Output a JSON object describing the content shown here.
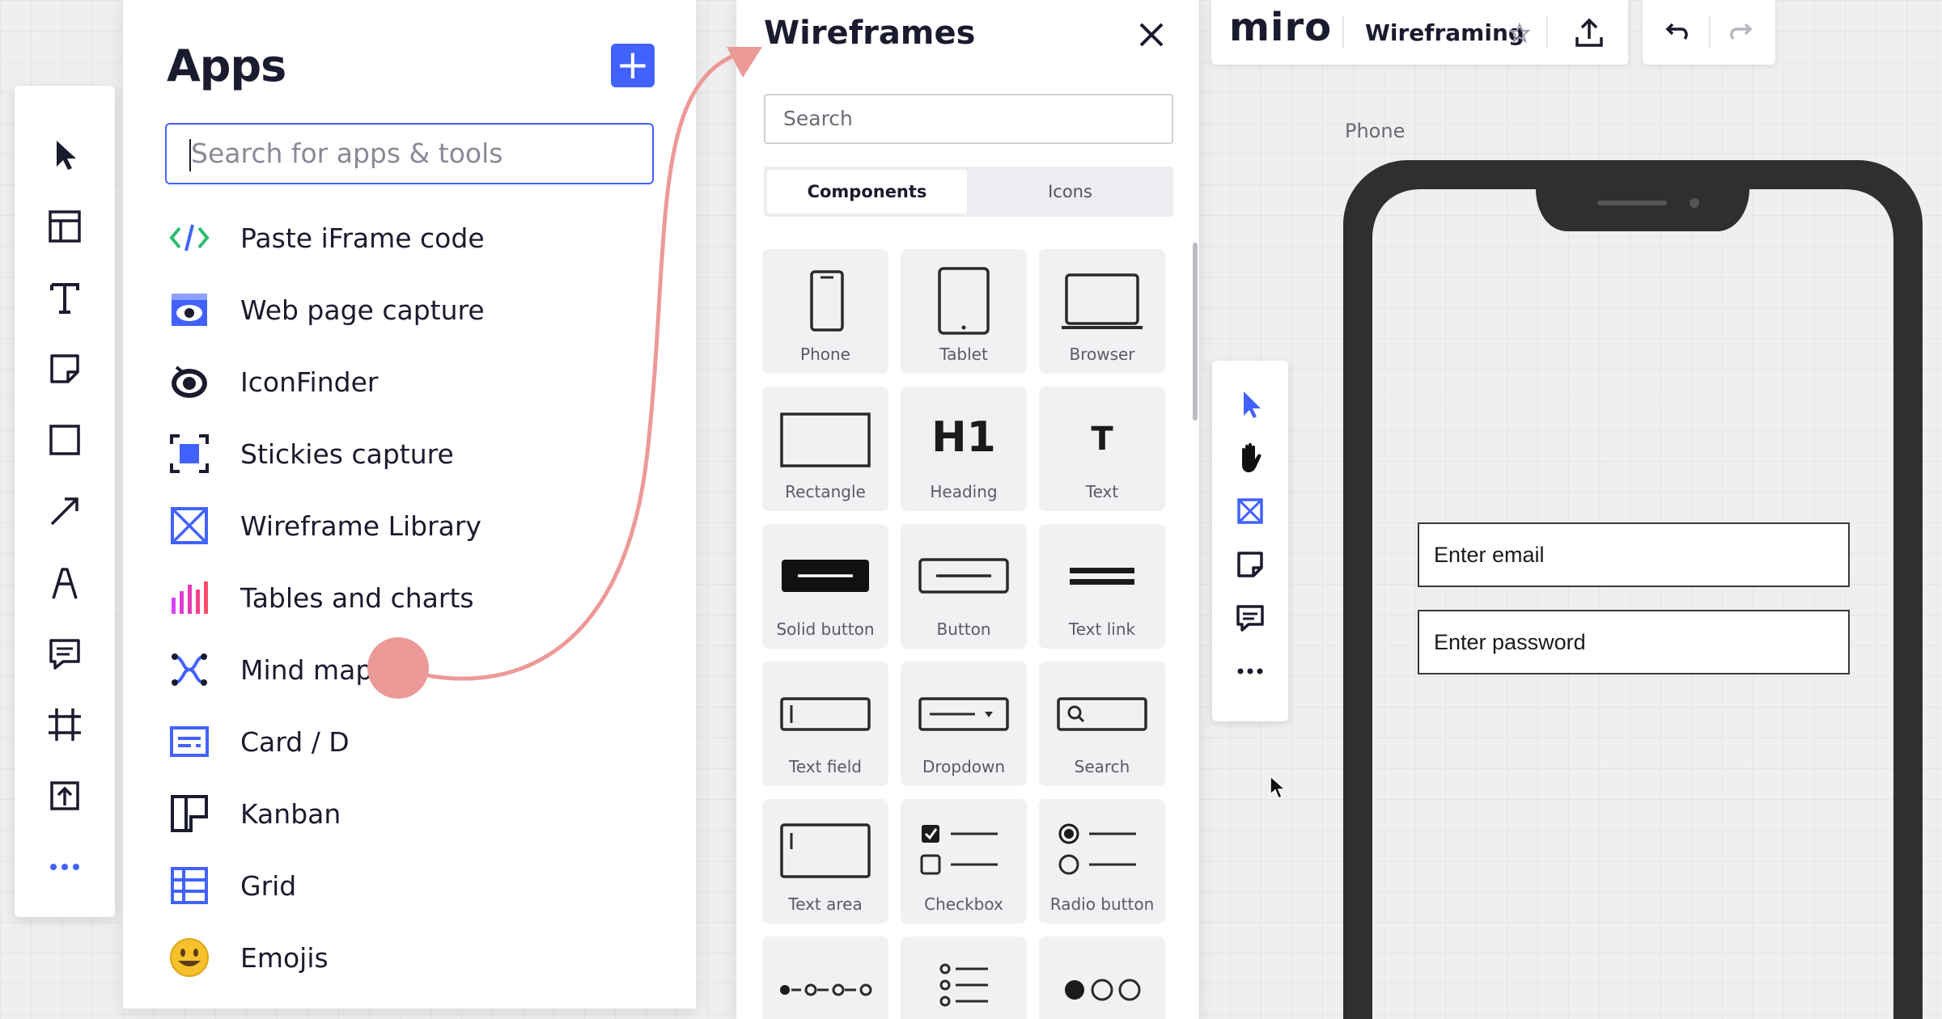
{
  "apps_panel": {
    "title": "Apps",
    "add_label": "+",
    "search_placeholder": "Search for apps & tools",
    "items": [
      {
        "label": "Paste iFrame code",
        "icon": "code-icon"
      },
      {
        "label": "Web page capture",
        "icon": "web-capture-icon"
      },
      {
        "label": "IconFinder",
        "icon": "iconfinder-icon"
      },
      {
        "label": "Stickies capture",
        "icon": "stickies-capture-icon"
      },
      {
        "label": "Wireframe Library",
        "icon": "wireframe-icon"
      },
      {
        "label": "Tables and charts",
        "icon": "bar-chart-icon"
      },
      {
        "label": "Mind map",
        "icon": "mind-map-icon"
      },
      {
        "label": "Card / D",
        "icon": "card-icon"
      },
      {
        "label": "Kanban",
        "icon": "kanban-icon"
      },
      {
        "label": "Grid",
        "icon": "grid-icon"
      },
      {
        "label": "Emojis",
        "icon": "emoji-icon"
      }
    ]
  },
  "wireframes_panel": {
    "title": "Wireframes",
    "search_placeholder": "Search",
    "tabs": {
      "components": "Components",
      "icons": "Icons"
    },
    "components": [
      "Phone",
      "Tablet",
      "Browser",
      "Rectangle",
      "Heading",
      "Text",
      "Solid button",
      "Button",
      "Text link",
      "Text field",
      "Dropdown",
      "Search",
      "Text area",
      "Checkbox",
      "Radio button",
      "",
      "",
      ""
    ],
    "glyphs": {
      "heading": "H1",
      "text": "T"
    }
  },
  "topbar": {
    "logo": "miro",
    "board_name": "Wireframing"
  },
  "canvas": {
    "frame_label": "Phone",
    "email_field": "Enter email",
    "password_field": "Enter password"
  },
  "colors": {
    "accent": "#4262ff",
    "highlight": "#ec9a98",
    "phone_body": "#2f2f2f"
  }
}
